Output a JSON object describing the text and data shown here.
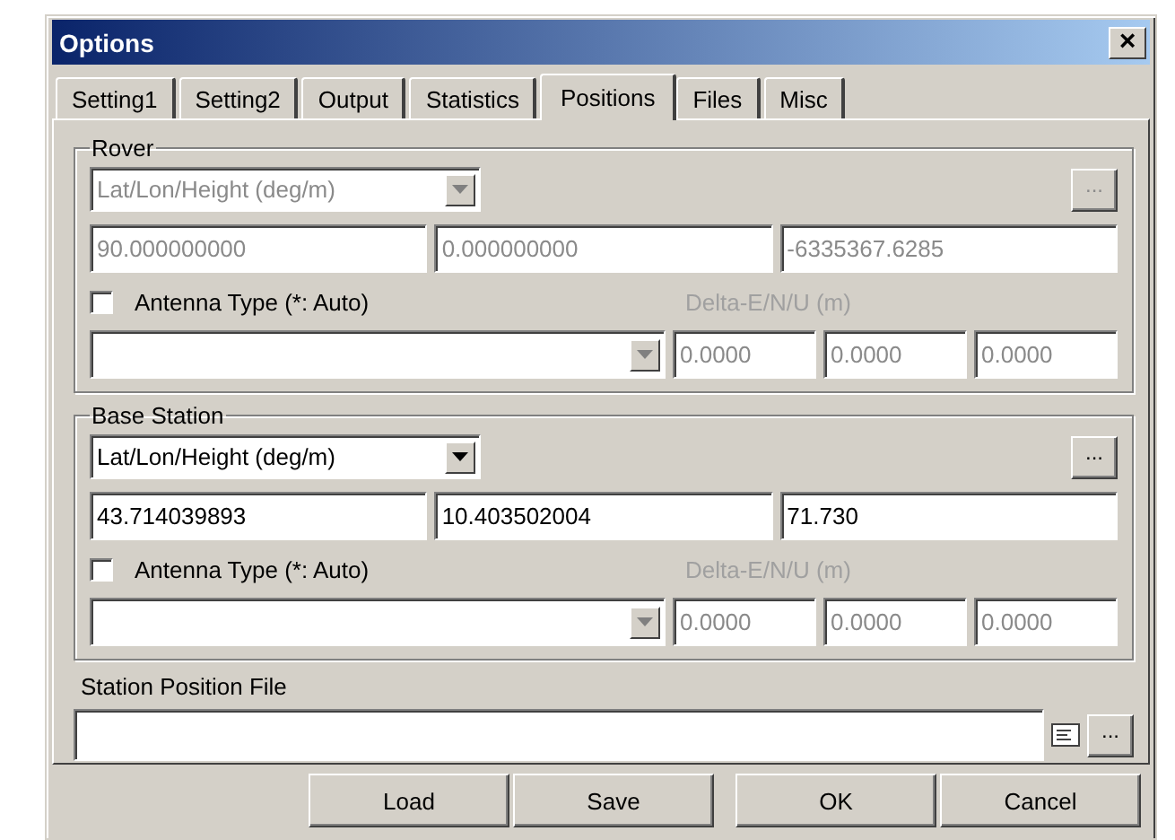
{
  "window": {
    "title": "Options",
    "close": "×"
  },
  "tabs": [
    {
      "label": "Setting1",
      "selected": false
    },
    {
      "label": "Setting2",
      "selected": false
    },
    {
      "label": "Output",
      "selected": false
    },
    {
      "label": "Statistics",
      "selected": false
    },
    {
      "label": "Positions",
      "selected": true
    },
    {
      "label": "Files",
      "selected": false
    },
    {
      "label": "Misc",
      "selected": false
    }
  ],
  "groups": [
    {
      "title": "Rover",
      "format": {
        "value": "Lat/Lon/Height (deg/m)",
        "disabled": true
      },
      "browse": {
        "label": "...",
        "disabled": true
      },
      "fields": [
        {
          "value": "90.000000000",
          "disabled": true
        },
        {
          "value": "0.000000000",
          "disabled": true
        },
        {
          "value": "-6335367.6285",
          "disabled": true
        }
      ],
      "antenna": {
        "label": "Antenna Type (*: Auto)",
        "checked": false
      },
      "delta_label": {
        "text": "Delta-E/N/U (m)",
        "disabled": true
      },
      "antenna_type": {
        "disabled": true
      },
      "deltas": [
        {
          "value": "0.0000",
          "disabled": true
        },
        {
          "value": "0.0000",
          "disabled": true
        },
        {
          "value": "0.0000",
          "disabled": true
        }
      ]
    },
    {
      "title": "Base Station",
      "format": {
        "value": "Lat/Lon/Height (deg/m)",
        "disabled": false
      },
      "browse": {
        "label": "...",
        "disabled": false
      },
      "fields": [
        {
          "value": "43.714039893",
          "disabled": false
        },
        {
          "value": "10.403502004",
          "disabled": false
        },
        {
          "value": "71.730",
          "disabled": false
        }
      ],
      "antenna": {
        "label": "Antenna Type (*: Auto)",
        "checked": false
      },
      "delta_label": {
        "text": "Delta-E/N/U (m)",
        "disabled": true
      },
      "antenna_type": {
        "disabled": true
      },
      "deltas": [
        {
          "value": "0.0000",
          "disabled": true
        },
        {
          "value": "0.0000",
          "disabled": true
        },
        {
          "value": "0.0000",
          "disabled": true
        }
      ]
    }
  ],
  "station_file": {
    "label": "Station Position File",
    "browse": "..."
  },
  "buttons": [
    {
      "label": "Load"
    },
    {
      "label": "Save"
    },
    {
      "label": "OK"
    },
    {
      "label": "Cancel"
    }
  ]
}
